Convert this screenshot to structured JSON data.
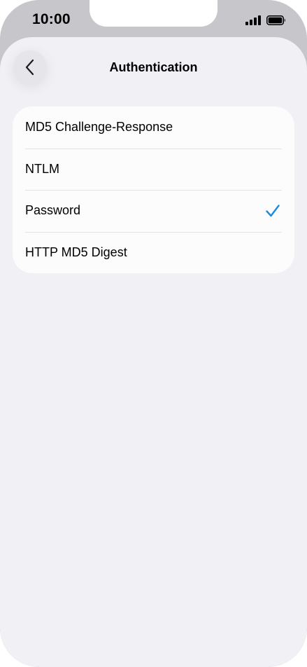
{
  "status_bar": {
    "time": "10:00",
    "icons": [
      "cellular-signal-icon",
      "battery-icon"
    ]
  },
  "nav": {
    "title": "Authentication",
    "back_icon": "chevron-left-icon"
  },
  "options": [
    {
      "label": "MD5 Challenge-Response",
      "selected": false
    },
    {
      "label": "NTLM",
      "selected": false
    },
    {
      "label": "Password",
      "selected": true
    },
    {
      "label": "HTTP MD5 Digest",
      "selected": false
    }
  ],
  "colors": {
    "accent": "#1a8cd8",
    "background": "#f0f0f5",
    "card": "#fcfcfd",
    "frame": "#c6c6cb"
  }
}
